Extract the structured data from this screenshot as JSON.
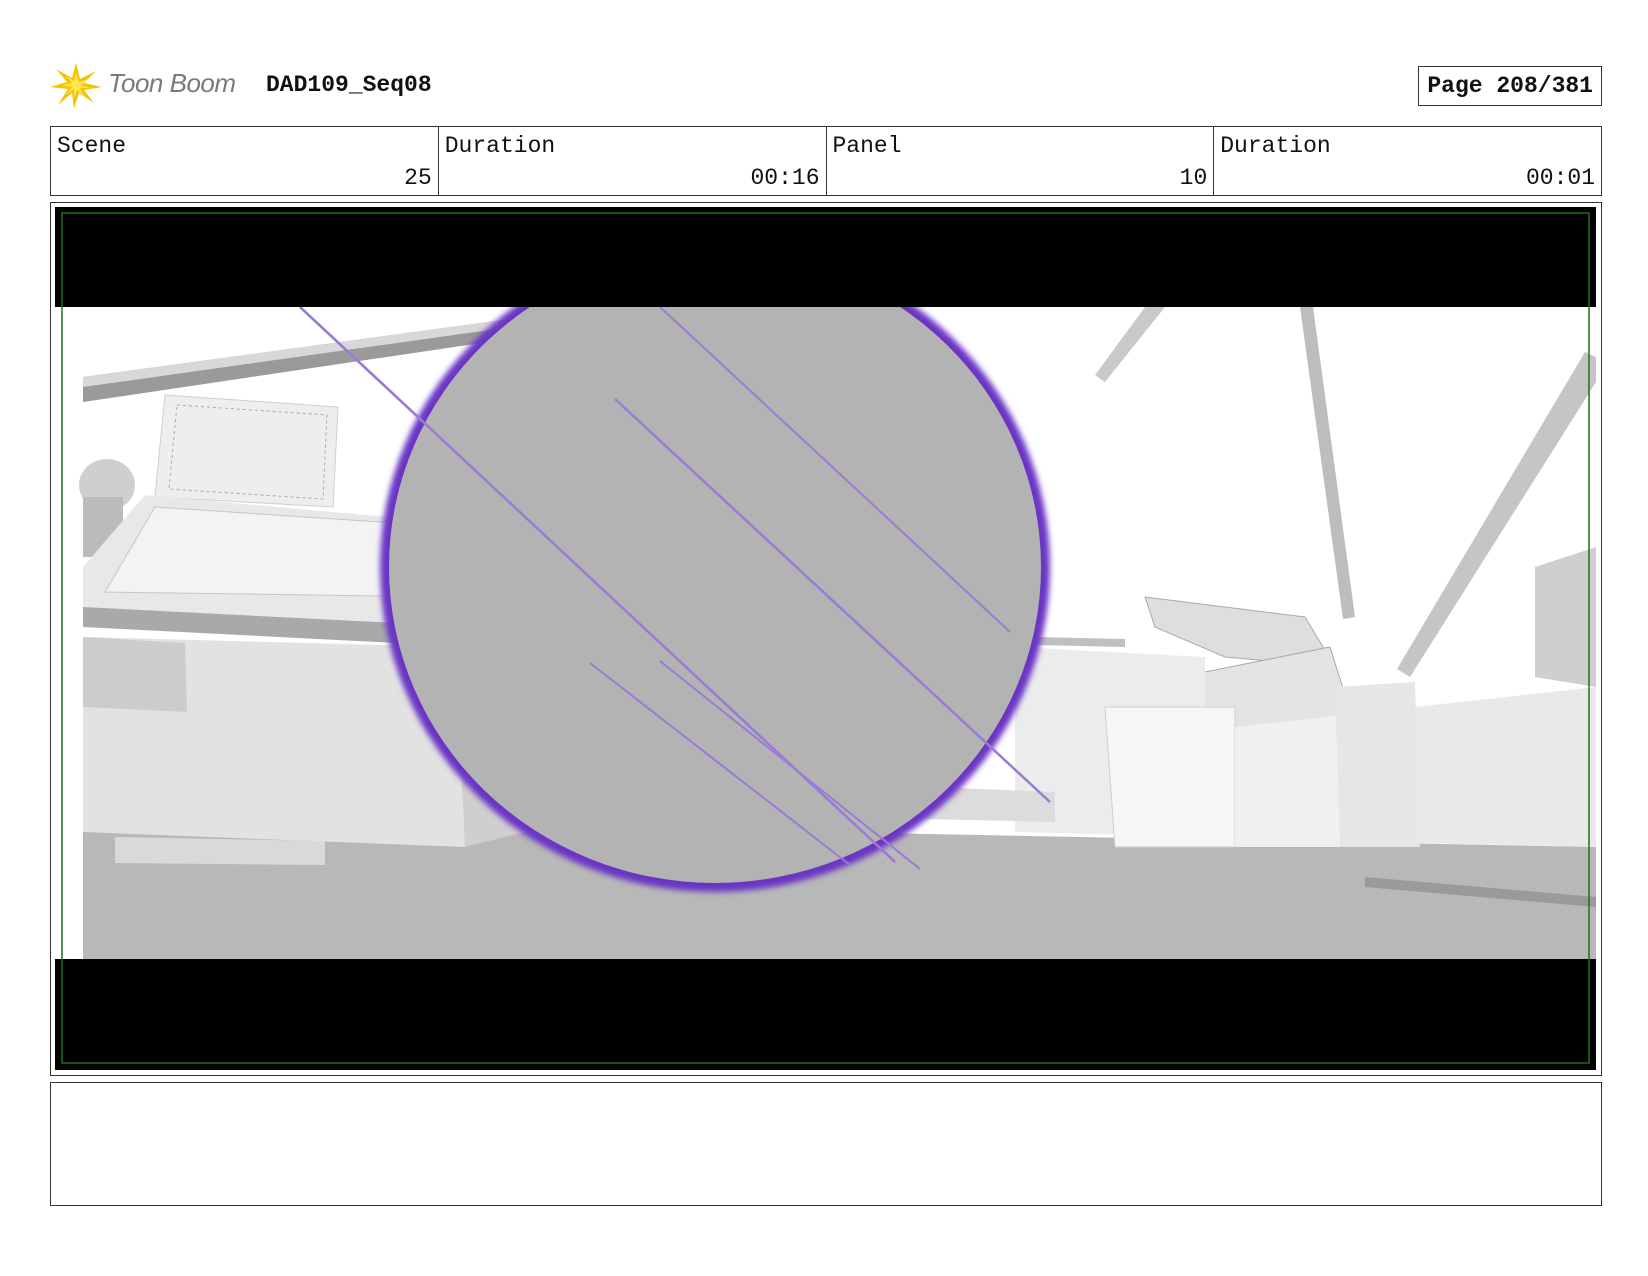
{
  "header": {
    "logo_text": "Toon Boom",
    "logo_icon": "toon-boom-star-burst-icon",
    "project_title": "DAD109_Seq08",
    "page_label": "Page 208/381"
  },
  "info": [
    {
      "label": "Scene",
      "value": "25"
    },
    {
      "label": "Duration",
      "value": "00:16"
    },
    {
      "label": "Panel",
      "value": "10"
    },
    {
      "label": "Duration",
      "value": "00:01"
    }
  ],
  "colors": {
    "safe_frame": "#1f6e1f",
    "bubble_fill": "#b3b3b3",
    "bubble_rim": "#6a35c4",
    "streak": "#9b7ad6",
    "letterbox": "#000000"
  },
  "notes": {
    "text": ""
  }
}
